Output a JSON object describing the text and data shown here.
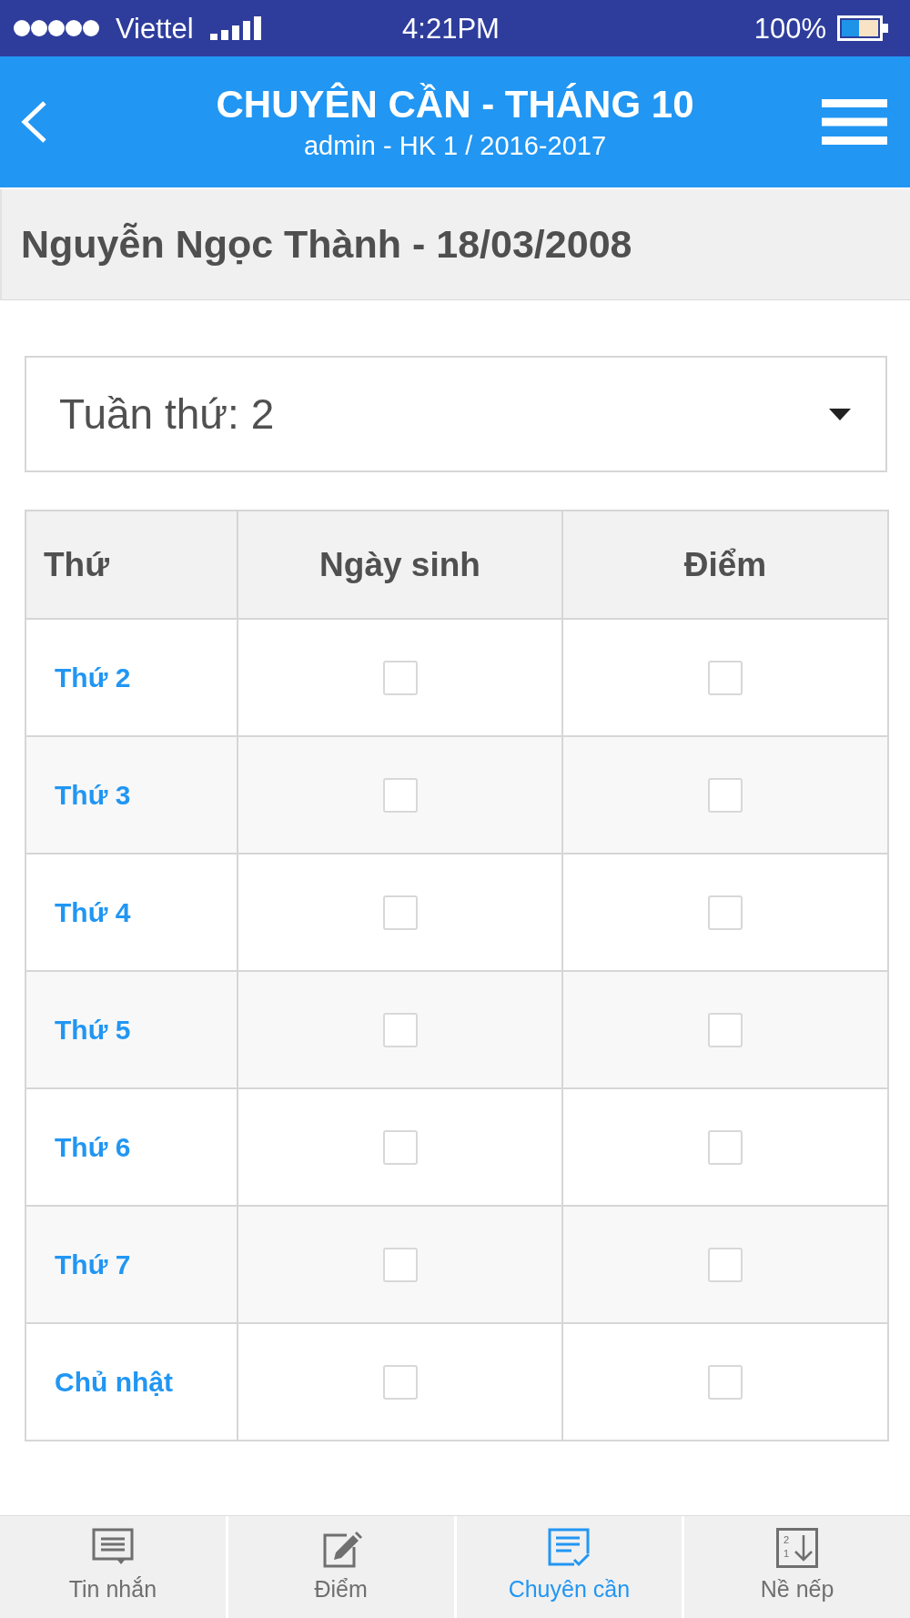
{
  "status_bar": {
    "carrier": "Viettel",
    "time": "4:21PM",
    "battery": "100%"
  },
  "header": {
    "title": "CHUYÊN CẦN - THÁNG 10",
    "subtitle": "admin - HK 1 / 2016-2017"
  },
  "student": {
    "name": "Nguyễn Ngọc Thành - 18/03/2008"
  },
  "week_select": {
    "value": "Tuần thứ: 2"
  },
  "table": {
    "columns": [
      "Thứ",
      "Ngày sinh",
      "Điểm"
    ],
    "rows": [
      {
        "day": "Thứ 2",
        "cells": [
          {
            "checked": false
          },
          {
            "checked": false
          }
        ]
      },
      {
        "day": "Thứ 3",
        "cells": [
          {
            "checked": false
          },
          {
            "checked": false
          }
        ]
      },
      {
        "day": "Thứ 4",
        "cells": [
          {
            "checked": false
          },
          {
            "checked": false
          }
        ]
      },
      {
        "day": "Thứ 5",
        "cells": [
          {
            "checked": false
          },
          {
            "checked": false
          }
        ]
      },
      {
        "day": "Thứ 6",
        "cells": [
          {
            "checked": false
          },
          {
            "checked": false
          }
        ]
      },
      {
        "day": "Thứ 7",
        "cells": [
          {
            "checked": false
          },
          {
            "checked": false
          }
        ]
      },
      {
        "day": "Chủ nhật",
        "cells": [
          {
            "checked": false
          },
          {
            "checked": false
          }
        ]
      }
    ]
  },
  "bottom_nav": [
    {
      "label": "Tin nhắn",
      "kind": "message",
      "selected": false
    },
    {
      "label": "Điểm",
      "kind": "edit",
      "selected": false
    },
    {
      "label": "Chuyên cần",
      "kind": "checklist",
      "selected": true
    },
    {
      "label": "Nề nếp",
      "kind": "sort",
      "icon_digits": [
        "2",
        "1"
      ],
      "selected": false
    }
  ]
}
